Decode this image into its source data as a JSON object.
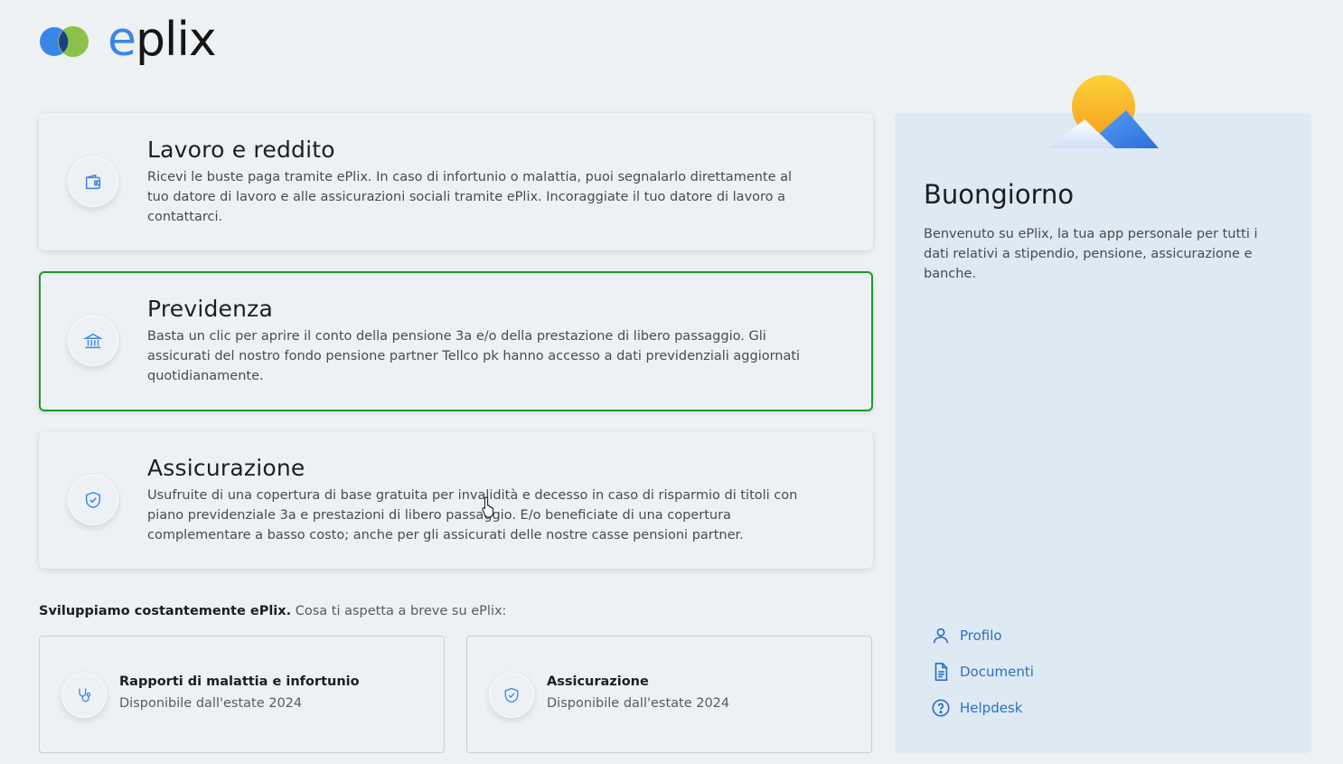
{
  "brand": {
    "name_prefix": "e",
    "name_rest": "plix",
    "colors": {
      "blue": "#3a86e8",
      "green": "#8bc34a",
      "navy": "#1d3f8a"
    }
  },
  "cards": [
    {
      "title": "Lavoro e reddito",
      "icon": "wallet-icon",
      "description": "Ricevi le buste paga tramite ePlix. In caso di infortunio o malattia, puoi segnalarlo direttamente al tuo datore di lavoro e alle assicurazioni sociali tramite ePlix. Incoraggiate il tuo datore di lavoro a contattarci."
    },
    {
      "title": "Previdenza",
      "icon": "bank-icon",
      "description": "Basta un clic per aprire il conto della pensione 3a e/o della prestazione di libero passaggio. Gli assicurati del nostro fondo pensione partner Tellco pk hanno accesso a dati previdenziali aggiornati quotidianamente.",
      "selected": true
    },
    {
      "title": "Assicurazione",
      "icon": "shield-check-icon",
      "description": "Usufruite di una copertura di base gratuita per invalidità e decesso in caso di risparmio di titoli con piano previdenziale 3a e prestazioni di libero passaggio. E/o beneficiate di una copertura complementare a basso costo; anche per gli assicurati delle nostre casse pensioni partner."
    }
  ],
  "promo": {
    "bold": "Sviluppiamo costantemente ePlix.",
    "rest": " Cosa ti aspetta a breve su ePlix:"
  },
  "upcoming": [
    {
      "title": "Rapporti di malattia e infortunio",
      "subtitle": "Disponibile dall'estate 2024",
      "icon": "stethoscope-icon"
    },
    {
      "title": "Assicurazione",
      "subtitle": "Disponibile dall'estate 2024",
      "icon": "shield-check-icon"
    }
  ],
  "panel": {
    "greeting": "Buongiorno",
    "welcome": "Benvenuto su ePlix, la tua app personale per tutti i dati relativi a stipendio, pensione, assicurazione e banche.",
    "links": [
      {
        "label": "Profilo",
        "icon": "user-icon"
      },
      {
        "label": "Documenti",
        "icon": "document-icon"
      },
      {
        "label": "Helpdesk",
        "icon": "help-icon"
      }
    ],
    "accent": "#2f6fbf"
  },
  "selection_color": "#1c9a2a"
}
